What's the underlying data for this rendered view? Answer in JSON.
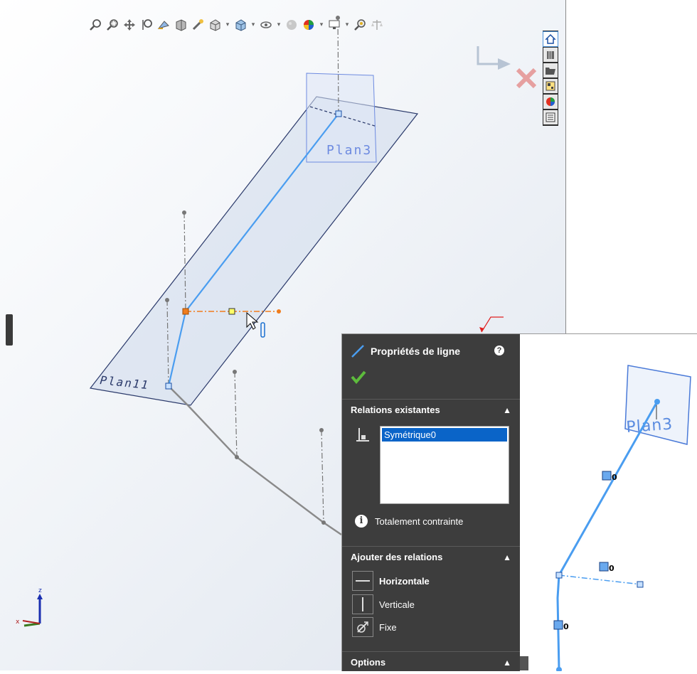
{
  "toolbar": {
    "icons": [
      "zoom-to-fit-icon",
      "zoom-to-area-icon",
      "pan-icon",
      "zoom-in-out-icon",
      "previous-view-icon",
      "section-view-icon",
      "dynamic-annotation-icon",
      "view-orientation-icon",
      "display-style-icon",
      "hide-show-items-icon",
      "edit-appearance-icon",
      "apply-scene-icon",
      "view-settings-icon",
      "render-tools-icon",
      "scale-icon"
    ]
  },
  "task_pane": {
    "icons": [
      "home-icon",
      "design-library-icon",
      "file-explorer-icon",
      "view-palette-icon",
      "appearances-icon",
      "custom-properties-icon"
    ]
  },
  "scene": {
    "plane_top_label": "Plan3",
    "plane_bottom_label": "Plan11"
  },
  "property_manager": {
    "title": "Propriétés de ligne",
    "help": "?",
    "relations_header": "Relations existantes",
    "relations": [
      "Symétrique0"
    ],
    "status": "Totalement contrainte",
    "add_header": "Ajouter des relations",
    "add_options": [
      "Horizontale",
      "Verticale",
      "Fixe"
    ],
    "options_header": "Options"
  },
  "inset": {
    "plane_label": "Plan3",
    "tag_top": "0",
    "tag_mid": "0",
    "tag_bottom": "0"
  },
  "triad": {
    "z": "z",
    "x": "x"
  },
  "colors": {
    "sketch_blue": "#4a9df0",
    "plane_fill": "#c8d4e8",
    "plane_edge": "#2b3a6b",
    "panel_bg": "#3d3d3d",
    "selection": "#0a64c8",
    "orange_axis": "#f07c1c"
  }
}
